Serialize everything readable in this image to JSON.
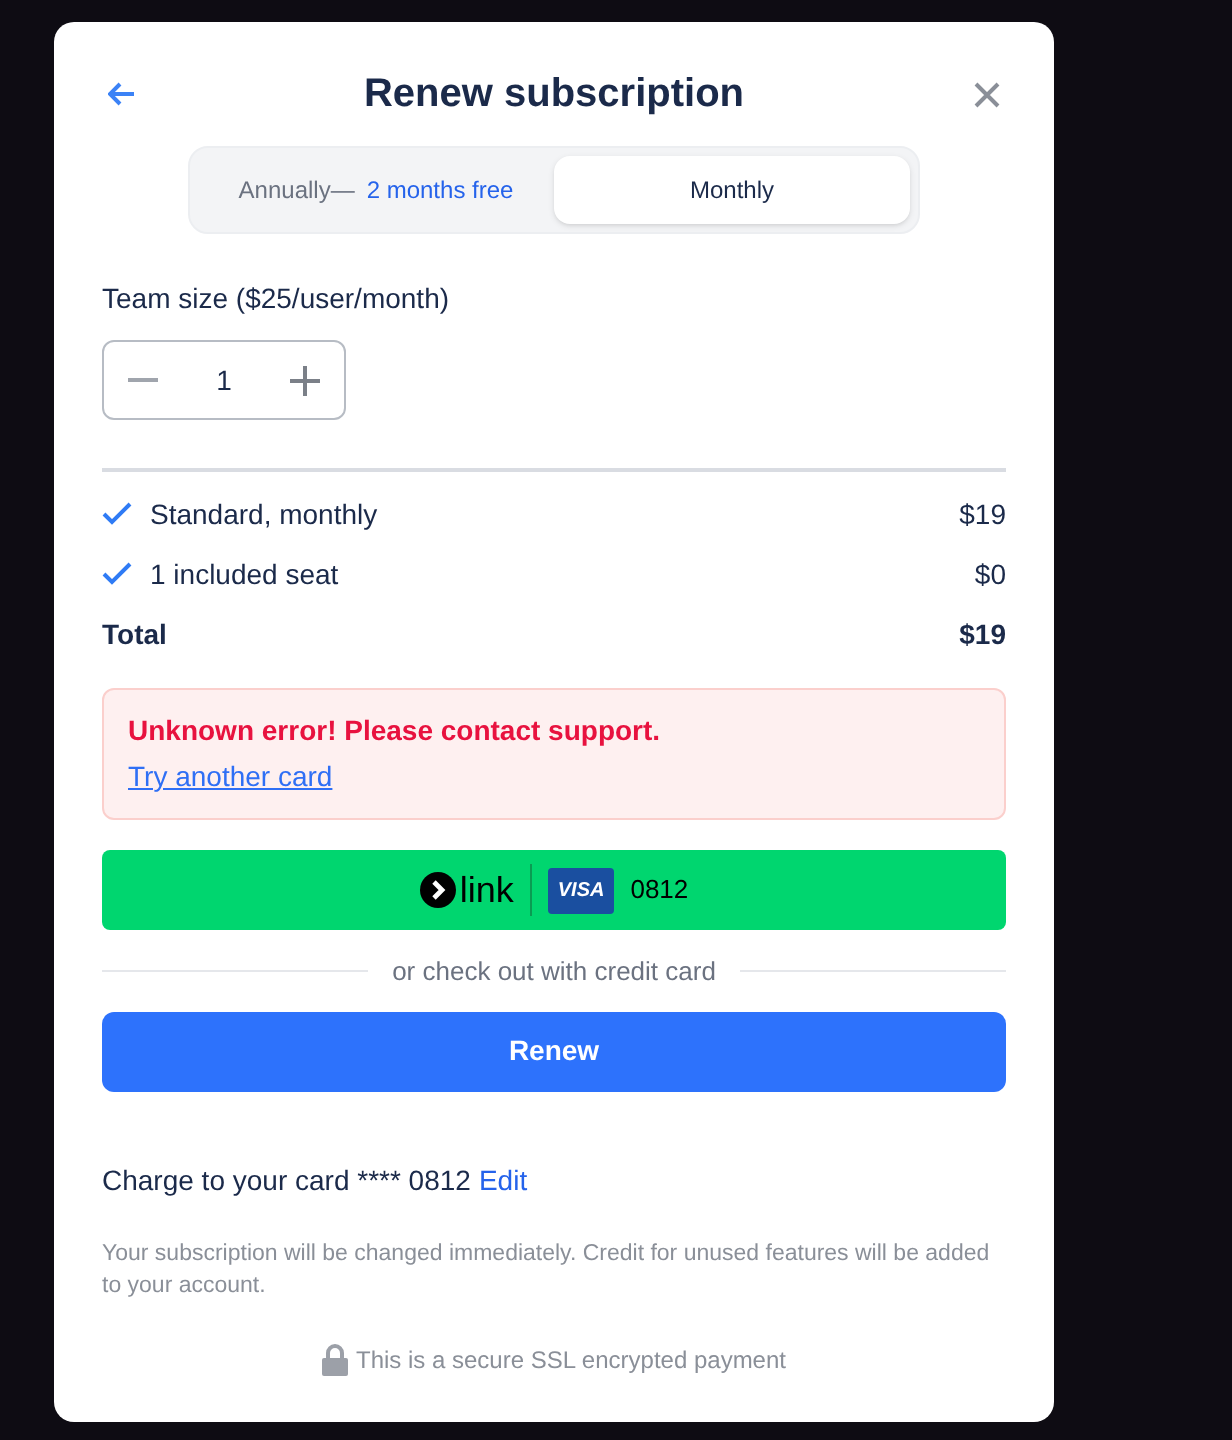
{
  "dialog": {
    "title": "Renew subscription"
  },
  "billing_tabs": [
    {
      "label": "Annually—",
      "note": "2 months free",
      "selected": false
    },
    {
      "label": "Monthly",
      "selected": true
    }
  ],
  "team_size": {
    "label": "Team size ($25/user/month)",
    "value": "1"
  },
  "line_items": [
    {
      "label": "Standard, monthly",
      "price": "$19",
      "checked": true
    },
    {
      "label": "1 included seat",
      "price": "$0",
      "checked": true
    }
  ],
  "total": {
    "label": "Total",
    "price": "$19"
  },
  "error": {
    "message": "Unknown error! Please contact support.",
    "link": "Try another card"
  },
  "link_button": {
    "brand": "link",
    "card_brand": "VISA",
    "card_last4": "0812"
  },
  "divider_text": "or check out with credit card",
  "renew_button": "Renew",
  "charge": {
    "text": "Charge to your card **** 0812",
    "edit": "Edit"
  },
  "notice": "Your subscription will be changed immediately. Credit for unused features will be added to your account.",
  "secure_note": "This is a secure SSL encrypted payment"
}
